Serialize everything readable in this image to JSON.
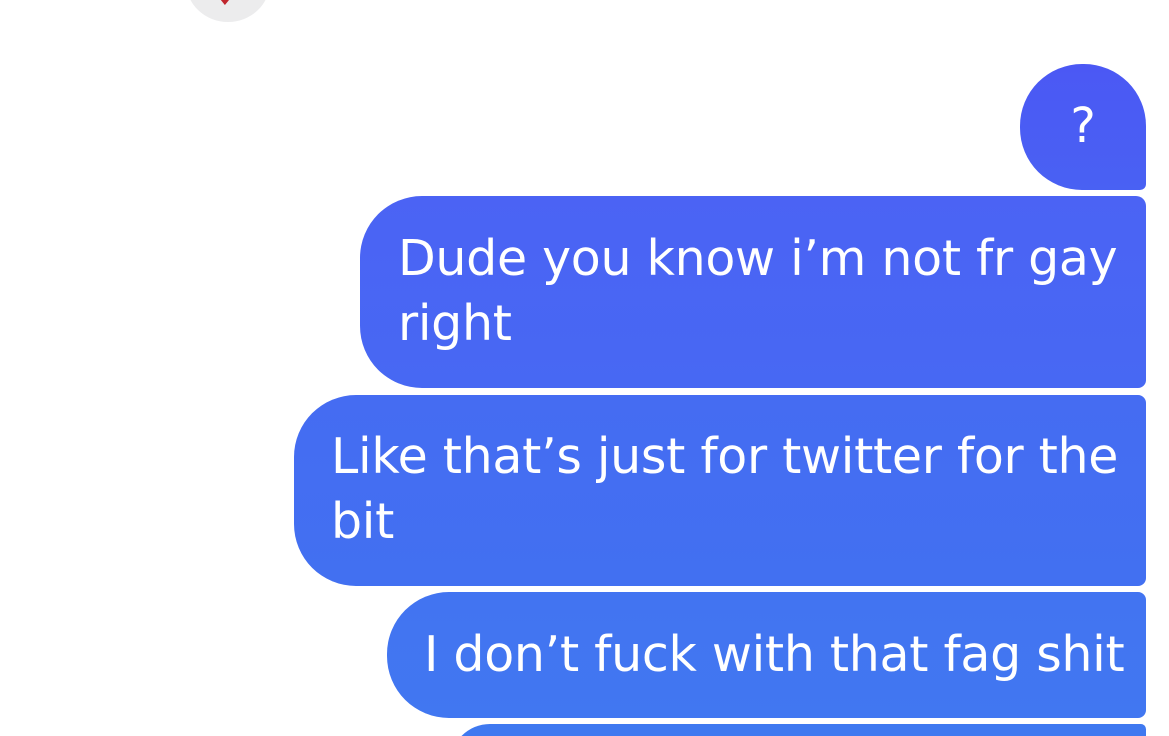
{
  "conversation": {
    "contact_avatar": {
      "icon": "heart-icon",
      "mark_color": "#c0262d",
      "mark_glyph": "♥"
    },
    "messages": [
      {
        "text": "?",
        "sender": "me"
      },
      {
        "text": "Dude you know i’m not fr gay\nright",
        "sender": "me"
      },
      {
        "text": "Like that’s just for twitter for the\nbit",
        "sender": "me"
      },
      {
        "text": "I don’t fuck with that fag shit",
        "sender": "me"
      }
    ],
    "colors": {
      "sent_bubble_top": "#4b58f4",
      "sent_bubble_bottom": "#3f79f0",
      "background": "#ffffff",
      "text": "#ffffff"
    }
  }
}
